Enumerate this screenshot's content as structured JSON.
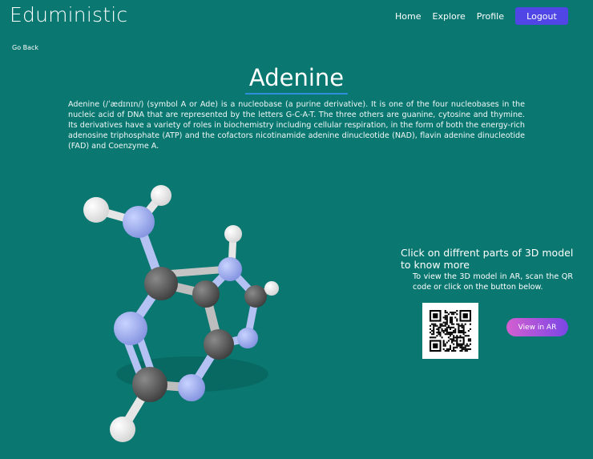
{
  "brand": "Eduministic",
  "nav": {
    "home": "Home",
    "explore": "Explore",
    "profile": "Profile",
    "logout": "Logout"
  },
  "go_back": "Go Back",
  "title": "Adenine",
  "description": "Adenine (/ˈædɪnɪn/) (symbol A or Ade) is a nucleobase (a purine derivative). It is one of the four nucleobases in the nucleic acid of DNA that are represented by the letters G-C-A-T. The three others are guanine, cytosine and thymine. Its derivatives have a variety of roles in biochemistry including cellular respiration, in the form of both the energy-rich adenosine triphosphate (ATP) and the cofactors nicotinamide adenine dinucleotide (NAD), flavin adenine dinucleotide (FAD) and Coenzyme A.",
  "info": {
    "heading": "Click on diffrent parts of 3D model to know more",
    "sub": "To view the 3D model in AR, scan the QR code or click on the button below."
  },
  "ar_button": "View in AR",
  "colors": {
    "background": "#0a7770",
    "accent": "#4f46e5",
    "underline": "#2f8fd8"
  },
  "model": {
    "atoms": [
      "hydrogen",
      "nitrogen",
      "carbon"
    ],
    "colors": {
      "hydrogen": "#ffffff",
      "nitrogen": "#a3b4f2",
      "carbon": "#5a5a5a"
    }
  }
}
